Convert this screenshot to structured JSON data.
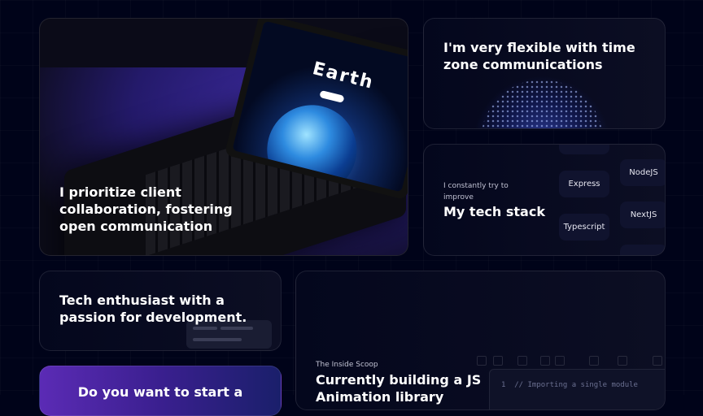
{
  "grid": {
    "card_collab": {
      "title": "I prioritize client collaboration, fostering open communication"
    },
    "card_timezone": {
      "title": "I'm very flexible with time zone communications"
    },
    "card_stack": {
      "subtitle": "I constantly try to improve",
      "title": "My tech stack",
      "left_items": [
        "Express",
        "Typescript"
      ],
      "right_items": [
        "NodeJS",
        "NextJS"
      ]
    },
    "card_enthusiast": {
      "title": "Tech enthusiast with a passion for development."
    },
    "card_building": {
      "subtitle": "The Inside Scoop",
      "title": "Currently building a JS Animation library",
      "code_line": "1  // Importing a single module"
    },
    "card_cta": {
      "title": "Do you want to start a"
    },
    "laptop_screen": {
      "title": "Earth"
    }
  },
  "colors": {
    "background": "#000319",
    "accent": "#5b2bb5"
  }
}
